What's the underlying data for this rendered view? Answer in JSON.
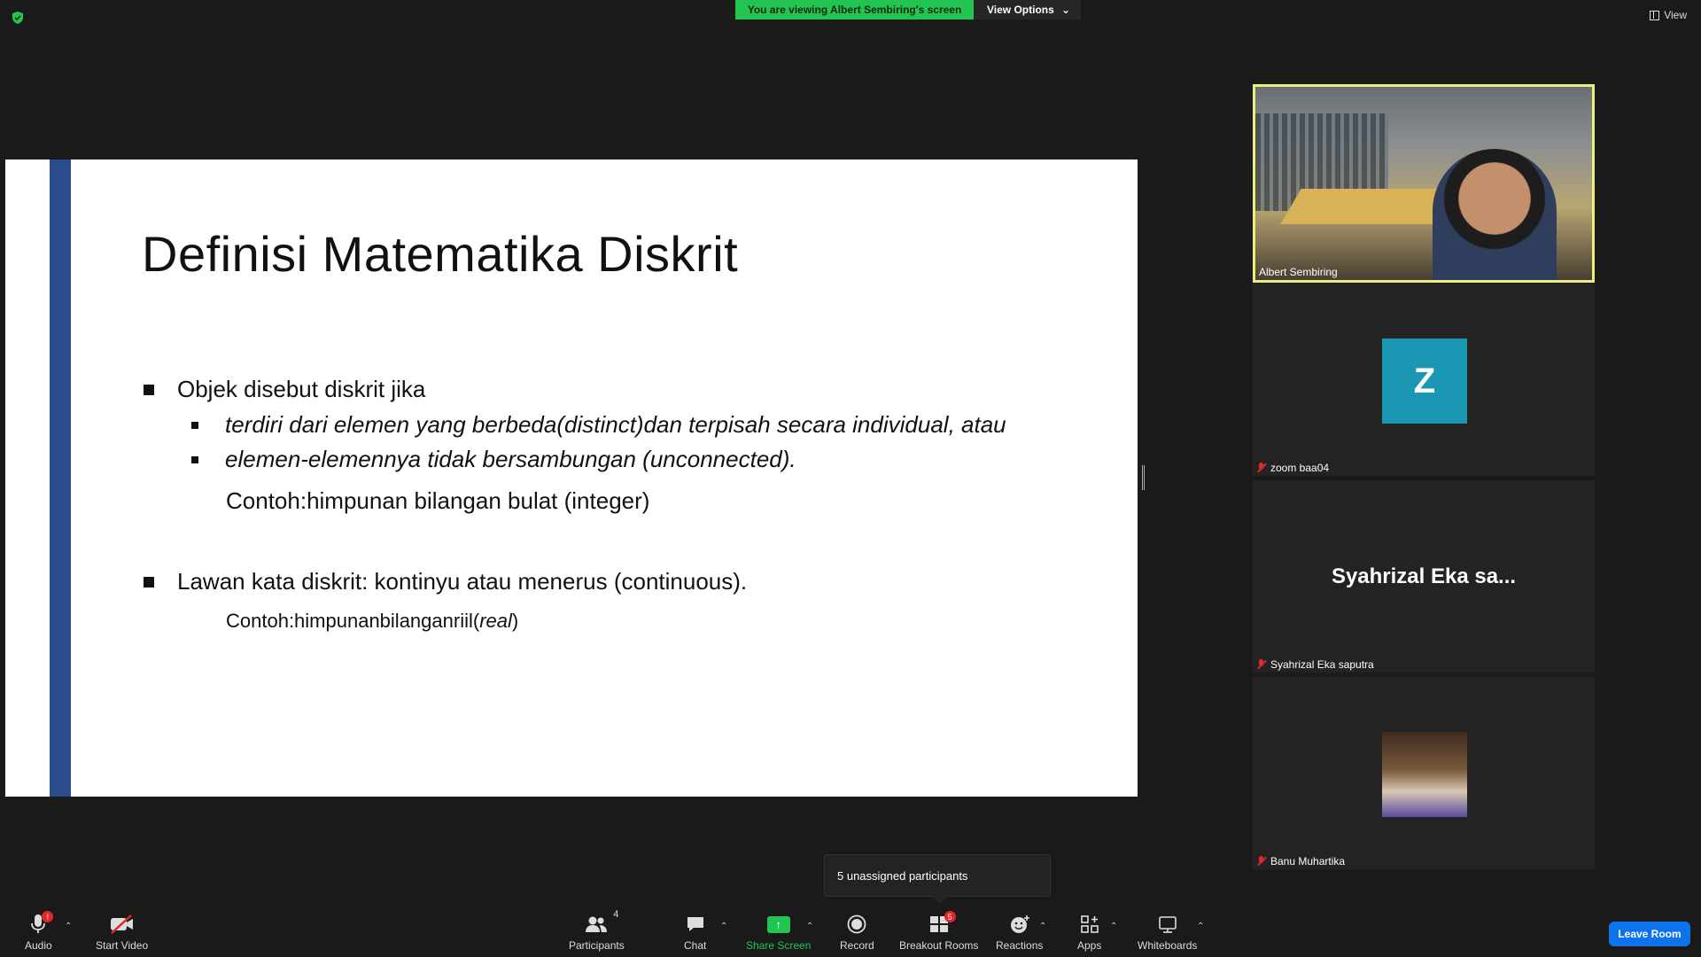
{
  "top": {
    "viewing_banner": "You are viewing Albert Sembiring's screen",
    "view_options": "View Options",
    "view_label": "View"
  },
  "slide": {
    "title": "Definisi Matematika Diskrit",
    "bullet1": "Objek disebut diskrit jika",
    "sub1": "terdiri dari elemen yang berbeda(distinct)dan terpisah secara individual, atau",
    "sub2": "elemen-elemennya tidak bersambungan (unconnected).",
    "example1": "Contoh:himpunan bilangan bulat (integer)",
    "bullet2": "Lawan kata diskrit: kontinyu atau menerus (continuous).",
    "example2_prefix": "Contoh:himpunanbilanganriil(",
    "example2_italic": "real",
    "example2_suffix": ")"
  },
  "participants": [
    {
      "name": "Albert Sembiring",
      "muted": false,
      "active": true
    },
    {
      "name": "zoom baa04",
      "muted": true,
      "avatar_letter": "Z",
      "avatar_color": "#1c97b3"
    },
    {
      "name": "Syahrizal Eka saputra",
      "display": "Syahrizal  Eka  sa...",
      "muted": true
    },
    {
      "name": "Banu Muhartika",
      "muted": true
    }
  ],
  "tooltip": "5 unassigned participants",
  "toolbar": {
    "audio": "Audio",
    "audio_badge": "!",
    "start_video": "Start Video",
    "participants": "Participants",
    "participants_count": "4",
    "chat": "Chat",
    "share_screen": "Share Screen",
    "record": "Record",
    "breakout_rooms": "Breakout Rooms",
    "breakout_badge": "5",
    "reactions": "Reactions",
    "apps": "Apps",
    "whiteboards": "Whiteboards",
    "leave_room": "Leave Room"
  },
  "colors": {
    "banner_green": "#23c552",
    "slide_bar": "#2b4d8c",
    "active_border": "#e9f07b",
    "leave_blue": "#0e72ed",
    "mute_red": "#e02828"
  },
  "icons": [
    "shield-icon",
    "grid-view-icon",
    "chevron-down-icon",
    "microphone-icon",
    "video-off-icon",
    "participants-icon",
    "chat-icon",
    "share-screen-icon",
    "record-icon",
    "breakout-rooms-icon",
    "reactions-icon",
    "apps-icon",
    "whiteboard-icon",
    "mute-icon"
  ]
}
